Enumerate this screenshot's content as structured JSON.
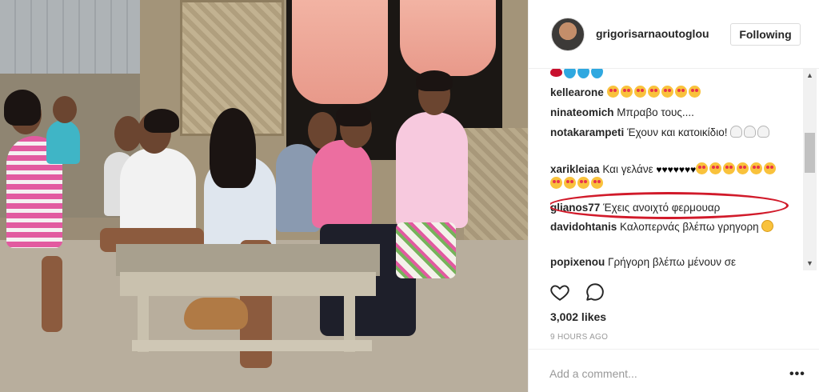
{
  "post": {
    "username": "grigorisarnaoutoglou",
    "follow_label": "Following",
    "likes": "3,002 likes",
    "time": "9 HOURS AGO",
    "add_comment_placeholder": "Add a comment...",
    "more_label": "•••"
  },
  "comments": [
    {
      "user": "",
      "text": "",
      "emojis": [
        "lips",
        "blue-heart",
        "blue-heart",
        "blue-heart"
      ]
    },
    {
      "user": "kellearone",
      "text": "",
      "emojis": [
        "heart-eyes",
        "heart-eyes",
        "heart-eyes",
        "heart-eyes",
        "heart-eyes",
        "heart-eyes",
        "heart-eyes"
      ]
    },
    {
      "user": "ninateomich",
      "text": "Μπραβο τους....",
      "emojis": []
    },
    {
      "user": "notakarampeti",
      "text": "Έχουν και κατοικίδιο!",
      "emojis": [
        "ghost",
        "ghost",
        "ghost"
      ]
    },
    {
      "user": "xarikleiaa",
      "text": "Και γελάνε",
      "emojis": [
        "black-heart",
        "black-heart",
        "black-heart",
        "black-heart",
        "black-heart",
        "black-heart",
        "black-heart",
        "heart-eyes",
        "heart-eyes",
        "heart-eyes",
        "heart-eyes",
        "heart-eyes",
        "heart-eyes",
        "heart-eyes",
        "heart-eyes",
        "heart-eyes",
        "heart-eyes"
      ]
    },
    {
      "user": "glianos77",
      "text": "Έχεις ανοιχτό φερμουαρ",
      "emojis": []
    },
    {
      "user": "davidohtanis",
      "text": "Καλοπερνάς βλέπω γρηγορη",
      "emojis": [
        "grin"
      ]
    },
    {
      "user": "popixenou",
      "text": "Γρήγορη βλέπω μένουν σε",
      "emojis": []
    }
  ],
  "scrollbar": {
    "up_arrow": "▲",
    "down_arrow": "▼"
  },
  "icons": {
    "like": "heart-icon",
    "comment": "comment-bubble-icon",
    "more": "more-options-icon"
  },
  "colors": {
    "highlight_ring": "#d11a2a",
    "text": "#262626",
    "muted": "#999999",
    "border": "#efefef"
  }
}
